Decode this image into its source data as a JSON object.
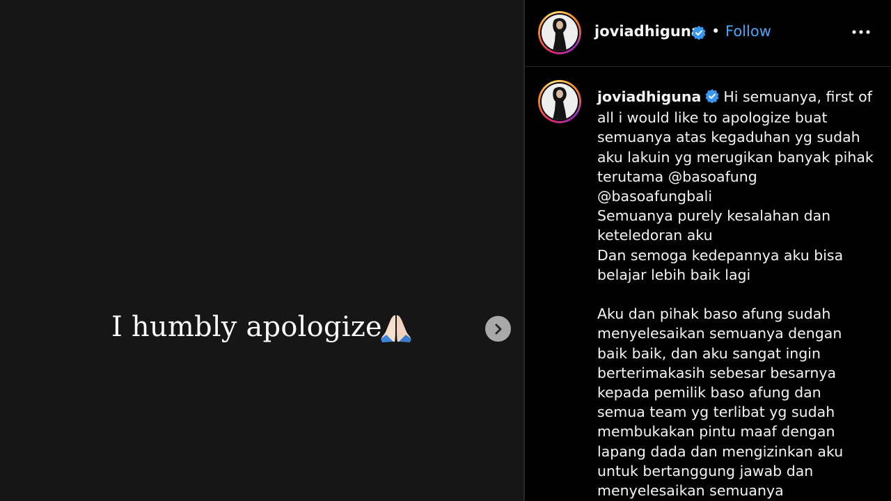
{
  "media": {
    "story_text": "I humbly apologize",
    "emoji_icon": "folded-hands-icon",
    "next_icon": "chevron-right-icon"
  },
  "header": {
    "username": "joviadhiguna",
    "verified_icon": "verified-badge-icon",
    "separator": "•",
    "follow_label": "Follow",
    "more_icon": "more-options-icon"
  },
  "caption": {
    "username": "joviadhiguna",
    "lines": [
      "Hi semuanya, first of",
      "all i would like to apologize buat",
      "semuanya atas kegaduhan yg sudah",
      "aku lakuin yg merugikan banyak pihak",
      "terutama @basoafung",
      "@basoafungbali",
      "Semuanya purely kesalahan dan",
      "keteledoran aku",
      "Dan semoga kedepannya aku bisa",
      "belajar lebih baik lagi",
      "",
      "Aku dan pihak baso afung sudah",
      "menyelesaikan semuanya dengan",
      "baik baik, dan aku sangat ingin",
      "berterimakasih sebesar besarnya",
      "kepada pemilik baso afung dan",
      "semua team yg terlibat yg sudah",
      "membukakan pintu maaf dengan",
      "lapang dada dan mengizinkan aku",
      "untuk bertanggung jawab dan",
      "menyelesaikan semuanya"
    ]
  },
  "colors": {
    "background": "#000000",
    "media_background": "#161616",
    "follow_blue": "#4aa6f5",
    "verified_blue": "#3897f0"
  }
}
